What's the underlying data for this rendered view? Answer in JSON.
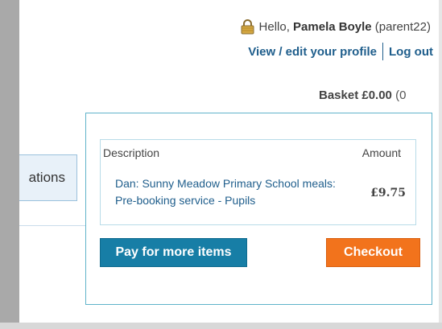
{
  "header": {
    "greeting_prefix": "Hello, ",
    "user_name": "Pamela Boyle",
    "username_paren": "(parent22)",
    "profile_link": "View / edit your profile",
    "logout_link": "Log out"
  },
  "basket": {
    "label": "Basket £0.00",
    "count_paren": "(0"
  },
  "nav": {
    "partial_tab_label": "ations"
  },
  "popup": {
    "col_description": "Description",
    "col_amount": "Amount",
    "items": [
      {
        "description": "Dan: Sunny Meadow Primary School meals: Pre-booking service - Pupils",
        "amount": "£9.75"
      }
    ],
    "pay_more_label": "Pay for more items",
    "checkout_label": "Checkout"
  },
  "colors": {
    "link_blue": "#1f5e8c",
    "pay_button": "#177ea6",
    "checkout_button": "#f2731c",
    "popup_border": "#5fb3ca"
  },
  "icons": {
    "user": "padlock-icon"
  }
}
